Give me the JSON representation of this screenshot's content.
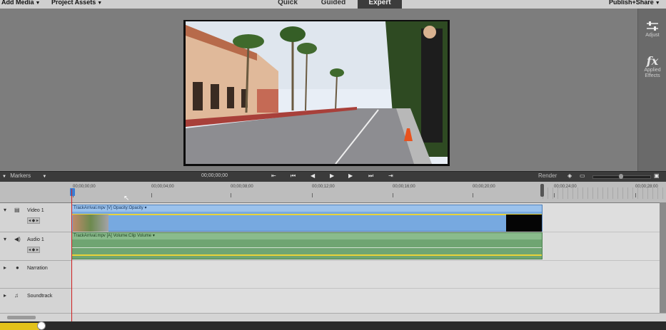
{
  "menubar": {
    "add_media": "Add Media",
    "project_assets": "Project Assets",
    "publish_share": "Publish+Share"
  },
  "mode_tabs": [
    {
      "label": "Quick",
      "active": false
    },
    {
      "label": "Guided",
      "active": false
    },
    {
      "label": "Expert",
      "active": true
    }
  ],
  "right_panel": {
    "adjust": "Adjust",
    "applied_effects": "Applied Effects"
  },
  "controlbar": {
    "markers": "Markers",
    "timecode": "00;00;00;00",
    "render": "Render"
  },
  "ruler": {
    "labels": [
      "00;00;00;00",
      "00;00;04;00",
      "00;00;08;00",
      "00;00;12;00",
      "00;00;16;00",
      "00;00;20;00",
      "00;00;24;00",
      "00;00;28;00"
    ]
  },
  "tracks": {
    "video": {
      "name": "Video 1",
      "clip_label": "TrackArrival.mpv [V] Opacity:Opacity ▾"
    },
    "audio": {
      "name": "Audio 1",
      "clip_label": "TrackArrival.mpv [A] Volume:Clip Volume ▾"
    },
    "narration": {
      "name": "Narration"
    },
    "soundtrack": {
      "name": "Soundtrack"
    }
  },
  "colors": {
    "video_clip": "#77a9e0",
    "audio_clip": "#6fa572",
    "playhead": "#d02020",
    "active_tab": "#3c3c3c"
  }
}
